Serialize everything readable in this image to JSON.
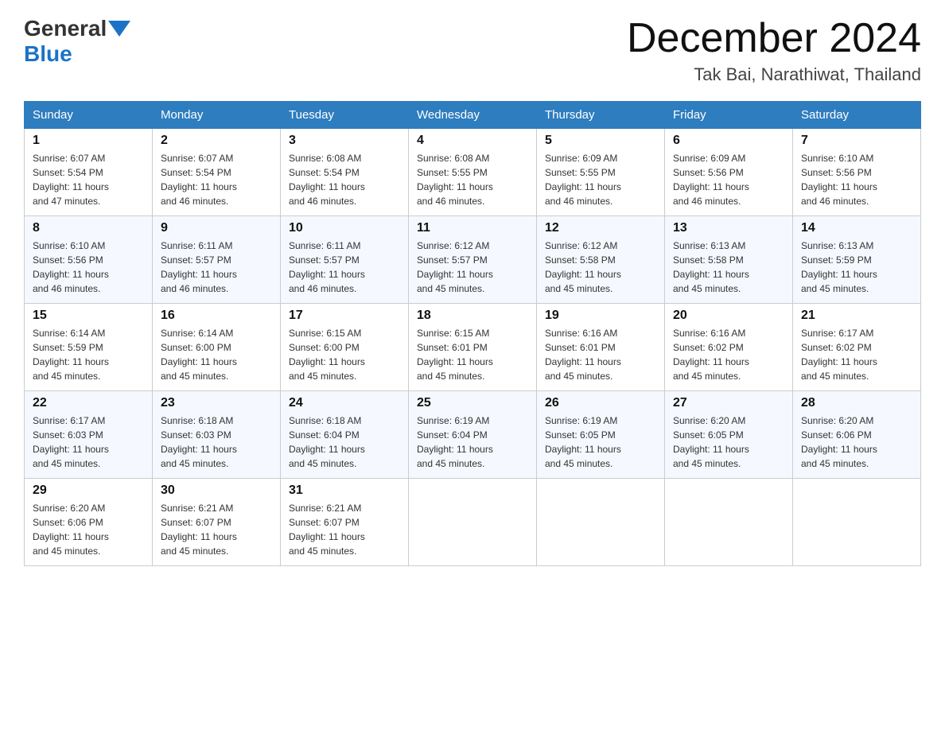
{
  "logo": {
    "general": "General",
    "blue": "Blue"
  },
  "header": {
    "title": "December 2024",
    "location": "Tak Bai, Narathiwat, Thailand"
  },
  "days_of_week": [
    "Sunday",
    "Monday",
    "Tuesday",
    "Wednesday",
    "Thursday",
    "Friday",
    "Saturday"
  ],
  "weeks": [
    [
      {
        "day": "1",
        "sunrise": "6:07 AM",
        "sunset": "5:54 PM",
        "daylight": "11 hours and 47 minutes."
      },
      {
        "day": "2",
        "sunrise": "6:07 AM",
        "sunset": "5:54 PM",
        "daylight": "11 hours and 46 minutes."
      },
      {
        "day": "3",
        "sunrise": "6:08 AM",
        "sunset": "5:54 PM",
        "daylight": "11 hours and 46 minutes."
      },
      {
        "day": "4",
        "sunrise": "6:08 AM",
        "sunset": "5:55 PM",
        "daylight": "11 hours and 46 minutes."
      },
      {
        "day": "5",
        "sunrise": "6:09 AM",
        "sunset": "5:55 PM",
        "daylight": "11 hours and 46 minutes."
      },
      {
        "day": "6",
        "sunrise": "6:09 AM",
        "sunset": "5:56 PM",
        "daylight": "11 hours and 46 minutes."
      },
      {
        "day": "7",
        "sunrise": "6:10 AM",
        "sunset": "5:56 PM",
        "daylight": "11 hours and 46 minutes."
      }
    ],
    [
      {
        "day": "8",
        "sunrise": "6:10 AM",
        "sunset": "5:56 PM",
        "daylight": "11 hours and 46 minutes."
      },
      {
        "day": "9",
        "sunrise": "6:11 AM",
        "sunset": "5:57 PM",
        "daylight": "11 hours and 46 minutes."
      },
      {
        "day": "10",
        "sunrise": "6:11 AM",
        "sunset": "5:57 PM",
        "daylight": "11 hours and 46 minutes."
      },
      {
        "day": "11",
        "sunrise": "6:12 AM",
        "sunset": "5:57 PM",
        "daylight": "11 hours and 45 minutes."
      },
      {
        "day": "12",
        "sunrise": "6:12 AM",
        "sunset": "5:58 PM",
        "daylight": "11 hours and 45 minutes."
      },
      {
        "day": "13",
        "sunrise": "6:13 AM",
        "sunset": "5:58 PM",
        "daylight": "11 hours and 45 minutes."
      },
      {
        "day": "14",
        "sunrise": "6:13 AM",
        "sunset": "5:59 PM",
        "daylight": "11 hours and 45 minutes."
      }
    ],
    [
      {
        "day": "15",
        "sunrise": "6:14 AM",
        "sunset": "5:59 PM",
        "daylight": "11 hours and 45 minutes."
      },
      {
        "day": "16",
        "sunrise": "6:14 AM",
        "sunset": "6:00 PM",
        "daylight": "11 hours and 45 minutes."
      },
      {
        "day": "17",
        "sunrise": "6:15 AM",
        "sunset": "6:00 PM",
        "daylight": "11 hours and 45 minutes."
      },
      {
        "day": "18",
        "sunrise": "6:15 AM",
        "sunset": "6:01 PM",
        "daylight": "11 hours and 45 minutes."
      },
      {
        "day": "19",
        "sunrise": "6:16 AM",
        "sunset": "6:01 PM",
        "daylight": "11 hours and 45 minutes."
      },
      {
        "day": "20",
        "sunrise": "6:16 AM",
        "sunset": "6:02 PM",
        "daylight": "11 hours and 45 minutes."
      },
      {
        "day": "21",
        "sunrise": "6:17 AM",
        "sunset": "6:02 PM",
        "daylight": "11 hours and 45 minutes."
      }
    ],
    [
      {
        "day": "22",
        "sunrise": "6:17 AM",
        "sunset": "6:03 PM",
        "daylight": "11 hours and 45 minutes."
      },
      {
        "day": "23",
        "sunrise": "6:18 AM",
        "sunset": "6:03 PM",
        "daylight": "11 hours and 45 minutes."
      },
      {
        "day": "24",
        "sunrise": "6:18 AM",
        "sunset": "6:04 PM",
        "daylight": "11 hours and 45 minutes."
      },
      {
        "day": "25",
        "sunrise": "6:19 AM",
        "sunset": "6:04 PM",
        "daylight": "11 hours and 45 minutes."
      },
      {
        "day": "26",
        "sunrise": "6:19 AM",
        "sunset": "6:05 PM",
        "daylight": "11 hours and 45 minutes."
      },
      {
        "day": "27",
        "sunrise": "6:20 AM",
        "sunset": "6:05 PM",
        "daylight": "11 hours and 45 minutes."
      },
      {
        "day": "28",
        "sunrise": "6:20 AM",
        "sunset": "6:06 PM",
        "daylight": "11 hours and 45 minutes."
      }
    ],
    [
      {
        "day": "29",
        "sunrise": "6:20 AM",
        "sunset": "6:06 PM",
        "daylight": "11 hours and 45 minutes."
      },
      {
        "day": "30",
        "sunrise": "6:21 AM",
        "sunset": "6:07 PM",
        "daylight": "11 hours and 45 minutes."
      },
      {
        "day": "31",
        "sunrise": "6:21 AM",
        "sunset": "6:07 PM",
        "daylight": "11 hours and 45 minutes."
      },
      null,
      null,
      null,
      null
    ]
  ],
  "labels": {
    "sunrise": "Sunrise:",
    "sunset": "Sunset:",
    "daylight": "Daylight:"
  }
}
